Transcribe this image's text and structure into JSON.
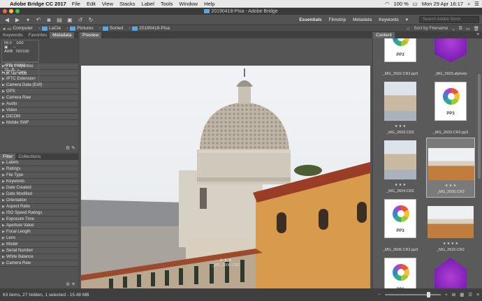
{
  "menubar": {
    "app": "Adobe Bridge CC 2017",
    "items": [
      "File",
      "Edit",
      "View",
      "Stacks",
      "Label",
      "Tools",
      "Window",
      "Help"
    ],
    "battery": "100 %",
    "datetime": "Mon 29 Apr  16:17"
  },
  "window": {
    "title": "20190418-Pisa - Adobe Bridge"
  },
  "toolbar": {
    "workspaces": [
      "Essentials",
      "Filmstrip",
      "Metadata",
      "Keywords"
    ],
    "active_workspace": "Essentials",
    "search_placeholder": "Search Adobe Stock"
  },
  "path": {
    "crumbs": [
      "Computer",
      "LaCie",
      "Pictures",
      "Sorted",
      "20190418-Pisa"
    ],
    "sort_label": "Sort by Filename"
  },
  "left_top_tabs": [
    "Keywords",
    "Favorites",
    "Metadata"
  ],
  "metadata_summary": {
    "fstop": "f/8.0",
    "shutter": "1/60",
    "dashes1": "--",
    "iso": "ISO100",
    "dims": "4272 x 2848",
    "size": "15...B",
    "size_dashes": "--",
    "profile": "Un...ed",
    "mode": "RGB"
  },
  "metadata_sections": [
    "File Properties",
    "IPTC Core",
    "IPTC Extension",
    "Camera Data (Exif)",
    "GPS",
    "Camera Raw",
    "Audio",
    "Video",
    "DICOM",
    "Mobile SWF"
  ],
  "filter_tabs": [
    "Filter",
    "Collections"
  ],
  "filter_items": [
    "Labels",
    "Ratings",
    "File Type",
    "Keywords",
    "Date Created",
    "Date Modified",
    "Orientation",
    "Aspect Ratio",
    "ISO Speed Ratings",
    "Exposure Time",
    "Aperture Value",
    "Focal Length",
    "Lens",
    "Model",
    "Serial Number",
    "White Balance",
    "Camera Raw"
  ],
  "preview": {
    "tab": "Preview",
    "rating": "★ ★ ★",
    "filename": "_MG_2606.CR2"
  },
  "content": {
    "tab": "Content",
    "items": [
      {
        "name": "_MG_2602.CR2.pp3",
        "type": "pp3",
        "stars": ""
      },
      {
        "name": "_MG_2603.afphoto",
        "type": "aff",
        "stars": ""
      },
      {
        "name": "_MG_2603.CR2",
        "type": "photo",
        "stars": "★ ★ ★"
      },
      {
        "name": "_MG_2603.CR2.pp3",
        "type": "pp3",
        "stars": ""
      },
      {
        "name": "_MG_2604.CR2",
        "type": "photo",
        "stars": "★ ★ ★"
      },
      {
        "name": "_MG_2606.CR2",
        "type": "photo",
        "stars": "★ ★ ★"
      },
      {
        "name": "_MG_2606.CR2.pp3",
        "type": "pp3",
        "stars": ""
      },
      {
        "name": "_MG_2610.CR2",
        "type": "photo",
        "stars": "★ ★ ★ ★"
      },
      {
        "name": "",
        "type": "pp3",
        "stars": ""
      },
      {
        "name": "",
        "type": "aff",
        "stars": ""
      }
    ],
    "pp3_label": "PP3"
  },
  "status": {
    "text": "63 items, 27 hidden, 1 selected - 15.48 MB"
  }
}
